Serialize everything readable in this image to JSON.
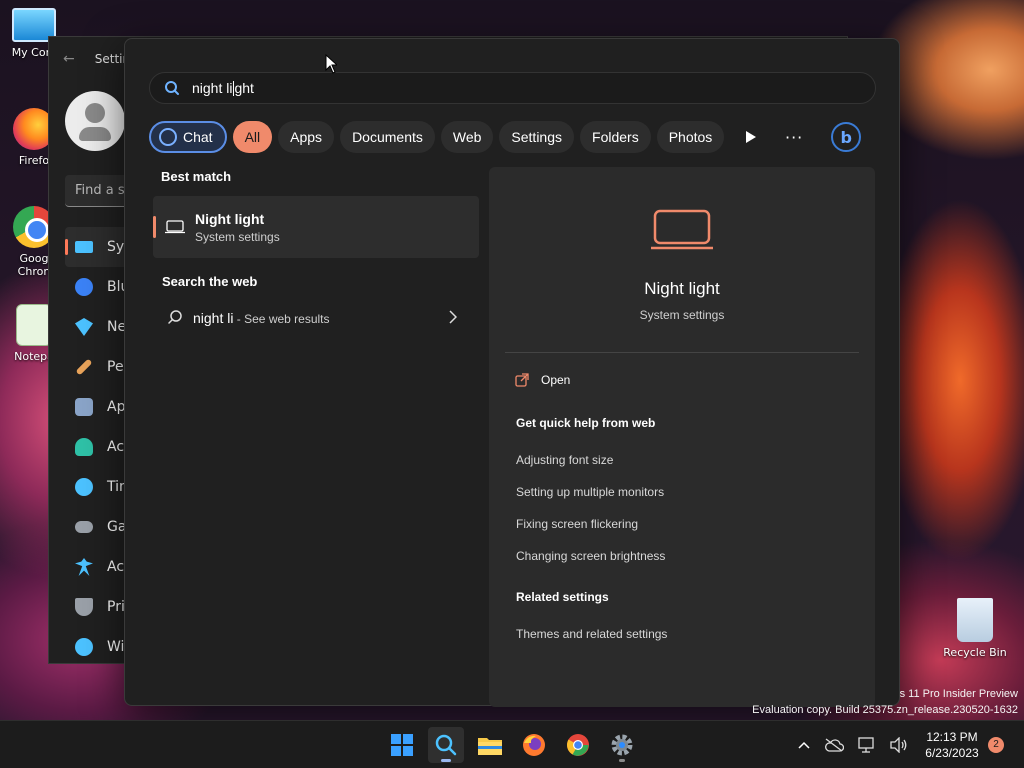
{
  "desktop": {
    "icons": [
      {
        "label": "My Com"
      },
      {
        "label": "Firefo"
      },
      {
        "label": "Goog\nChron"
      },
      {
        "label": "Notepa"
      },
      {
        "label": "Recycle Bin"
      }
    ],
    "watermark_line1": "s 11 Pro Insider Preview",
    "watermark_line2": "Evaluation copy. Build 25375.zn_release.230520-1632"
  },
  "settings_window": {
    "title": "Settin",
    "find_placeholder": "Find a se",
    "nav": [
      {
        "label": "Sys",
        "icon": "monitor-icon",
        "color": "#4cc2ff"
      },
      {
        "label": "Blu",
        "icon": "bluetooth-icon",
        "color": "#3b82f6"
      },
      {
        "label": "Ne",
        "icon": "wifi-icon",
        "color": "#4cc2ff"
      },
      {
        "label": "Per",
        "icon": "brush-icon",
        "color": "#e8a35a"
      },
      {
        "label": "Ap",
        "icon": "apps-icon",
        "color": "#8aa4c8"
      },
      {
        "label": "Ac",
        "icon": "person-icon",
        "color": "#2fc1a7"
      },
      {
        "label": "Tin",
        "icon": "clock-globe-icon",
        "color": "#4cc2ff"
      },
      {
        "label": "Ga",
        "icon": "gamepad-icon",
        "color": "#9aa0a8"
      },
      {
        "label": "Ac",
        "icon": "accessibility-icon",
        "color": "#4cc2ff"
      },
      {
        "label": "Pri",
        "icon": "shield-icon",
        "color": "#9aa0a8"
      },
      {
        "label": "Wi",
        "icon": "update-icon",
        "color": "#4cc2ff"
      }
    ]
  },
  "search": {
    "query_before_caret": "night li",
    "query_after_caret": "ght",
    "filters": [
      {
        "label": "Chat",
        "style": "chat"
      },
      {
        "label": "All",
        "style": "selected"
      },
      {
        "label": "Apps"
      },
      {
        "label": "Documents"
      },
      {
        "label": "Web"
      },
      {
        "label": "Settings"
      },
      {
        "label": "Folders"
      },
      {
        "label": "Photos"
      }
    ],
    "more_label": "···",
    "best_match_heading": "Best match",
    "best_match": {
      "title": "Night light",
      "subtitle": "System settings"
    },
    "search_web_heading": "Search the web",
    "web_result": {
      "query": "night li",
      "hint": " - See web results"
    }
  },
  "detail": {
    "title": "Night light",
    "subtitle": "System settings",
    "open_label": "Open",
    "quick_help_heading": "Get quick help from web",
    "quick_help_links": [
      "Adjusting font size",
      "Setting up multiple monitors",
      "Fixing screen flickering",
      "Changing screen brightness"
    ],
    "related_heading": "Related settings",
    "related_links": [
      "Themes and related settings"
    ]
  },
  "taskbar": {
    "time": "12:13 PM",
    "date": "6/23/2023",
    "notification_count": "2",
    "accent": "#f08a6b"
  }
}
